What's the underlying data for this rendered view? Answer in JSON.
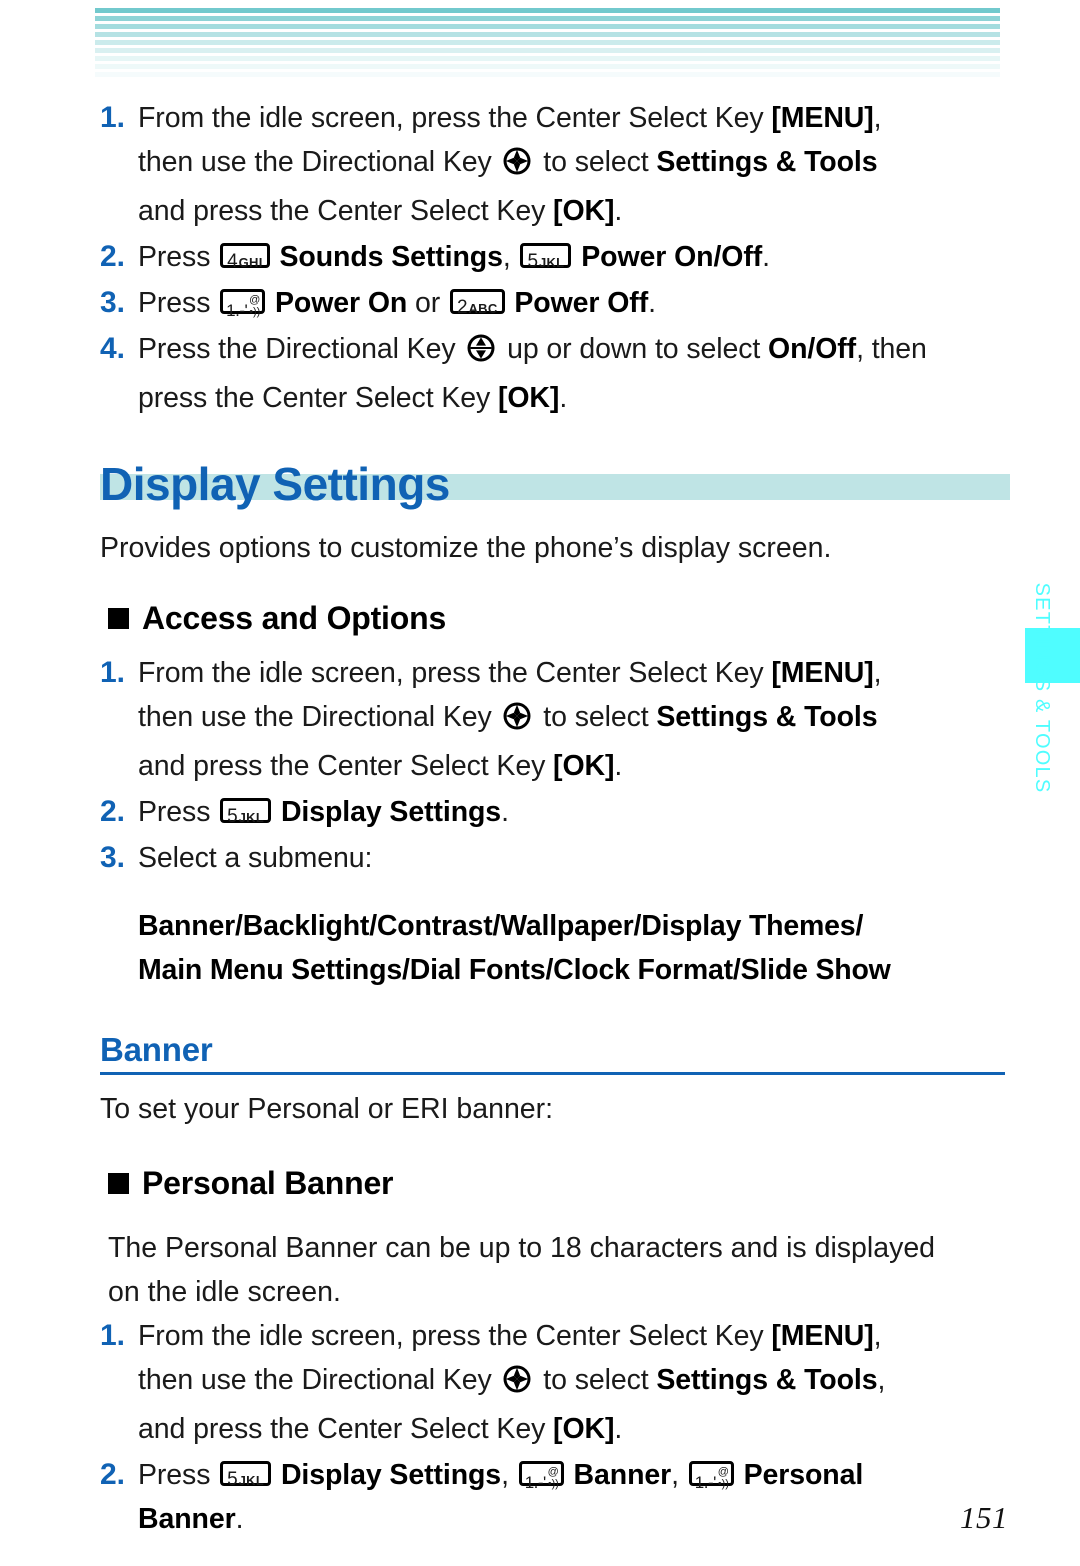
{
  "page": {
    "number": "151",
    "side_tab_label": "SETTINGS & TOOLS",
    "colors": {
      "heading_blue": "#1062b4",
      "band_teal": "#bfe4e5",
      "tab_cyan": "#4ffdff",
      "body_black": "#1a1a1a"
    }
  },
  "header_stripes": [
    {
      "color": "#72c9cd",
      "height": 5,
      "gap": 3
    },
    {
      "color": "#8ed3d6",
      "height": 5,
      "gap": 3
    },
    {
      "color": "#a3dcde",
      "height": 5,
      "gap": 3
    },
    {
      "color": "#b5e2e4",
      "height": 5,
      "gap": 3
    },
    {
      "color": "#cbebec",
      "height": 5,
      "gap": 3
    },
    {
      "color": "#d9f0f1",
      "height": 5,
      "gap": 3
    },
    {
      "color": "#e6f6f6",
      "height": 5,
      "gap": 3
    },
    {
      "color": "#eef9f9",
      "height": 5,
      "gap": 3
    },
    {
      "color": "#f5fbfc",
      "height": 5,
      "gap": 3
    }
  ],
  "keys": {
    "k1": {
      "name": "key-1",
      "digit": "1.-'",
      "at": "@",
      "voicemail": "•))"
    },
    "k2": {
      "name": "key-2",
      "digit": "2",
      "letters": "ABC"
    },
    "k4": {
      "name": "key-4",
      "digit": "4",
      "letters": "GHI"
    },
    "k5": {
      "name": "key-5",
      "digit": "5",
      "letters": "JKL"
    }
  },
  "top_steps": {
    "step1": {
      "num": "1.",
      "line1_a": "From the idle screen, press the Center Select Key ",
      "line1_b": "[MENU]",
      "line1_c": ",",
      "line2_a": "then use the Directional Key ",
      "line2_b": " to select ",
      "line2_c": "Settings & Tools",
      "line3_a": "and press the Center Select Key ",
      "line3_b": "[OK]",
      "line3_c": "."
    },
    "step2": {
      "num": "2.",
      "a": "Press ",
      "b": "Sounds Settings",
      "c": ", ",
      "d": "Power On/Off",
      "e": "."
    },
    "step3": {
      "num": "3.",
      "a": "Press ",
      "b": "Power On",
      "c": " or ",
      "d": "Power Off",
      "e": "."
    },
    "step4": {
      "num": "4.",
      "line1_a": "Press the Directional Key ",
      "line1_b": " up or down to select ",
      "line1_c": "On/Off",
      "line1_d": ", then",
      "line2_a": "press the Center Select Key ",
      "line2_b": "[OK]",
      "line2_c": "."
    }
  },
  "display_settings": {
    "title": "Display Settings",
    "lead": "Provides options to customize the phone’s display screen.",
    "access_heading": "Access and Options",
    "step1": {
      "num": "1.",
      "line1_a": "From the idle screen, press the Center Select Key ",
      "line1_b": "[MENU]",
      "line1_c": ",",
      "line2_a": "then use the Directional Key ",
      "line2_b": " to select ",
      "line2_c": "Settings & Tools",
      "line3_a": "and press the Center Select Key ",
      "line3_b": "[OK]",
      "line3_c": "."
    },
    "step2": {
      "num": "2.",
      "a": "Press ",
      "b": "Display Settings",
      "c": "."
    },
    "step3": {
      "num": "3.",
      "a": "Select a submenu:"
    },
    "submenu_line1": "Banner/Backlight/Contrast/Wallpaper/Display Themes/",
    "submenu_line2": "Main Menu Settings/Dial Fonts/Clock Format/Slide Show"
  },
  "banner": {
    "title": "Banner",
    "lead": "To set your Personal or ERI banner:",
    "personal_heading": "Personal Banner",
    "personal_para_line1": "The Personal Banner can be up to 18 characters and is displayed",
    "personal_para_line2": "on the idle screen.",
    "step1": {
      "num": "1.",
      "line1_a": "From the idle screen, press the Center Select Key ",
      "line1_b": "[MENU]",
      "line1_c": ",",
      "line2_a": "then use the Directional Key ",
      "line2_b": " to select ",
      "line2_c": "Settings & Tools",
      "line2_d": ",",
      "line3_a": "and press the Center Select Key ",
      "line3_b": "[OK]",
      "line3_c": "."
    },
    "step2": {
      "num": "2.",
      "a": "Press ",
      "b": "Display Settings",
      "c": ", ",
      "d": "Banner",
      "e": ", ",
      "f": "Personal",
      "g": "Banner",
      "h": "."
    }
  }
}
